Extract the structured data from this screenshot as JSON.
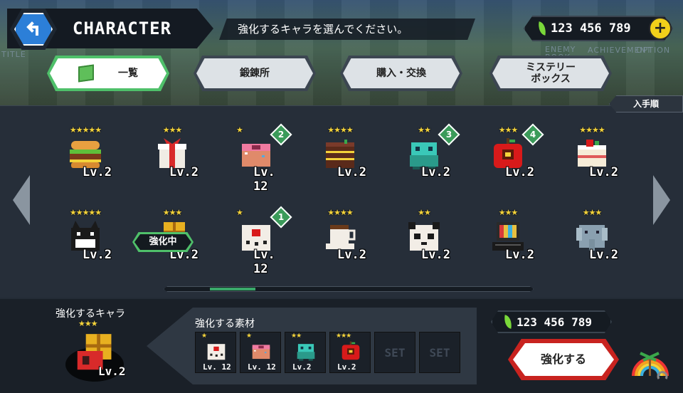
{
  "header": {
    "title": "CHARACTER",
    "instruction": "強化するキャラを選んでください。",
    "coins": "123 456 789",
    "ghost_labels": [
      "TITLE",
      "ENEMY BOOK",
      "ACHIEVEMENT",
      "OPTION"
    ]
  },
  "tabs": [
    {
      "label": "一覧",
      "active": true
    },
    {
      "label": "鍛錬所",
      "active": false
    },
    {
      "label": "購入・交換",
      "active": false
    },
    {
      "label": "ミステリー\nボックス",
      "active": false
    }
  ],
  "sort_label": "入手順",
  "grid": [
    {
      "stars": "★★★★★",
      "level": "Lv.2",
      "sprite": "hamburger",
      "badge": ""
    },
    {
      "stars": "★★★",
      "level": "Lv.2",
      "sprite": "gift-box",
      "badge": ""
    },
    {
      "stars": "★",
      "level": "Lv. 12",
      "sprite": "donut",
      "badge": "2"
    },
    {
      "stars": "★★★★",
      "level": "Lv.2",
      "sprite": "cake-slice",
      "badge": ""
    },
    {
      "stars": "★★",
      "level": "Lv.2",
      "sprite": "teal-robot",
      "badge": "3"
    },
    {
      "stars": "★★★",
      "level": "Lv.2",
      "sprite": "apple",
      "badge": "4"
    },
    {
      "stars": "★★★★",
      "level": "Lv.2",
      "sprite": "shortcake",
      "badge": ""
    },
    {
      "stars": "★★★★★",
      "level": "Lv.2",
      "sprite": "black-cat",
      "badge": ""
    },
    {
      "stars": "★★★",
      "level": "Lv.2",
      "sprite": "gold-box",
      "badge": ""
    },
    {
      "stars": "★",
      "level": "Lv. 12",
      "sprite": "dice",
      "badge": "1"
    },
    {
      "stars": "★★★★",
      "level": "Lv.2",
      "sprite": "coffee-cup",
      "badge": ""
    },
    {
      "stars": "★★",
      "level": "Lv.2",
      "sprite": "panda",
      "badge": ""
    },
    {
      "stars": "★★★",
      "level": "Lv.2",
      "sprite": "retro-pc",
      "badge": ""
    },
    {
      "stars": "★★★",
      "level": "Lv.2",
      "sprite": "elephant",
      "badge": ""
    }
  ],
  "enhancing_tag": "強化中",
  "scroll_position_fraction": 0.14,
  "selected": {
    "label": "強化するキャラ",
    "stars": "★★★",
    "level": "Lv.2",
    "sprite": "gold-box"
  },
  "materials": {
    "label": "強化する素材",
    "slots": [
      {
        "stars": "★",
        "level": "Lv. 12",
        "sprite": "dice"
      },
      {
        "stars": "★",
        "level": "Lv. 12",
        "sprite": "donut"
      },
      {
        "stars": "★★",
        "level": "Lv.2",
        "sprite": "teal-robot"
      },
      {
        "stars": "★★★",
        "level": "Lv.2",
        "sprite": "apple"
      },
      {
        "set": "SET"
      },
      {
        "set": "SET"
      }
    ]
  },
  "bottom_coins": "123 456 789",
  "enhance_button": "強化する",
  "colors": {
    "accent_green": "#4fc06a",
    "coin_leaf": "#7ad83a",
    "enhance_red": "#c8231f",
    "star_gold": "#f3d23a",
    "plus_yellow": "#f2d01a"
  }
}
